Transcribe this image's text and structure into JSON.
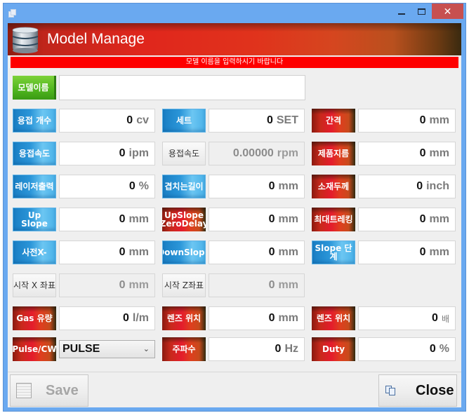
{
  "window": {
    "controls": {
      "minimize": "minimize",
      "maximize": "maximize",
      "close": "✕"
    }
  },
  "header": {
    "title": "Model Manage",
    "icon": "database-icon"
  },
  "warning": "모델 이름을 입력하시기 바랍니다",
  "model_name": {
    "label": "모델이름",
    "value": "",
    "placeholder": ""
  },
  "rows": [
    [
      {
        "label": "용접 개수",
        "style": "blue",
        "value": "0",
        "unit": "cv",
        "disabled": false
      },
      {
        "label": "세트",
        "style": "blue",
        "value": "0",
        "unit": "SET",
        "disabled": false
      },
      {
        "label": "간격",
        "style": "red",
        "value": "0",
        "unit": "mm",
        "disabled": false
      }
    ],
    [
      {
        "label": "용접속도",
        "style": "blue",
        "value": "0",
        "unit": "ipm",
        "disabled": false
      },
      {
        "label": "용접속도",
        "style": "gray",
        "value": "0.00000",
        "unit": "rpm",
        "disabled": true
      },
      {
        "label": "제품지름",
        "style": "red",
        "value": "0",
        "unit": "mm",
        "disabled": false
      }
    ],
    [
      {
        "label": "레이저출력",
        "style": "blue",
        "value": "0",
        "unit": "%",
        "disabled": false
      },
      {
        "label": "겹치는길이",
        "style": "blue",
        "value": "0",
        "unit": "mm",
        "disabled": false
      },
      {
        "label": "소재두께",
        "style": "red",
        "value": "0",
        "unit": "inch",
        "disabled": false
      }
    ],
    [
      {
        "label": "Up Slope",
        "style": "blue",
        "value": "0",
        "unit": "mm",
        "disabled": false
      },
      {
        "label": "UpSlope ZeroDelay",
        "style": "red",
        "value": "0",
        "unit": "mm",
        "disabled": false
      },
      {
        "label": "최대트레킹",
        "style": "red",
        "value": "0",
        "unit": "mm",
        "disabled": false
      }
    ],
    [
      {
        "label": "사전X-",
        "style": "blue",
        "value": "0",
        "unit": "mm",
        "disabled": false
      },
      {
        "label": "DownSlope",
        "style": "blue",
        "value": "0",
        "unit": "mm",
        "disabled": false
      },
      {
        "label": "Slope 단계",
        "style": "blue",
        "value": "0",
        "unit": "mm",
        "disabled": false
      }
    ],
    [
      {
        "label": "시작 X 좌표",
        "style": "gray",
        "value": "0",
        "unit": "mm",
        "disabled": true
      },
      {
        "label": "시작 Z좌표",
        "style": "gray",
        "value": "0",
        "unit": "mm",
        "disabled": true
      }
    ],
    [
      {
        "label": "Gas 유량",
        "style": "red",
        "value": "0",
        "unit": "l/m",
        "disabled": false
      },
      {
        "label": "렌즈 위치",
        "style": "red",
        "value": "0",
        "unit": "mm",
        "disabled": false
      },
      {
        "label": "렌즈 위치",
        "style": "red",
        "value": "0",
        "unit": "배",
        "disabled": false
      }
    ]
  ],
  "last_row": {
    "mode_label": "Pulse/CW",
    "mode_value": "PULSE",
    "freq": {
      "label": "주파수",
      "value": "0",
      "unit": "Hz"
    },
    "duty": {
      "label": "Duty",
      "value": "0",
      "unit": "%"
    }
  },
  "footer": {
    "save_label": "Save",
    "close_label": "Close"
  }
}
